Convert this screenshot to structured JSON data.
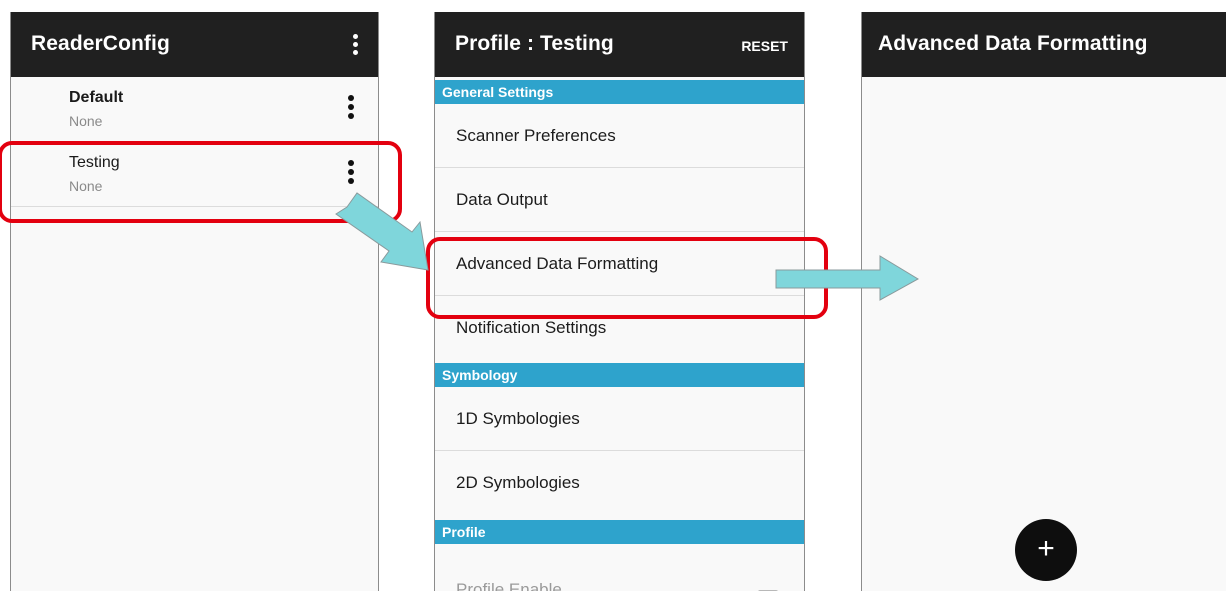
{
  "screens": {
    "reader_config": {
      "title": "ReaderConfig",
      "profiles": [
        {
          "name": "Default",
          "subtitle": "None"
        },
        {
          "name": "Testing",
          "subtitle": "None"
        }
      ]
    },
    "profile": {
      "title": "Profile : Testing",
      "reset_label": "RESET",
      "sections": [
        {
          "header": "General Settings",
          "items": [
            "Scanner Preferences",
            "Data Output",
            "Advanced Data Formatting",
            "Notification Settings"
          ]
        },
        {
          "header": "Symbology",
          "items": [
            "1D Symbologies",
            "2D Symbologies"
          ]
        },
        {
          "header": "Profile",
          "items": [
            "Profile Enable"
          ]
        }
      ]
    },
    "advanced": {
      "title": "Advanced Data Formatting",
      "fab_label": "+"
    }
  },
  "colors": {
    "appbar": "#202020",
    "section_header": "#2ea3cc",
    "highlight": "#e3000f",
    "arrow": "#7fd6db"
  },
  "icons": [
    "overflow-menu-icon",
    "plus-icon",
    "checkbox-icon"
  ]
}
